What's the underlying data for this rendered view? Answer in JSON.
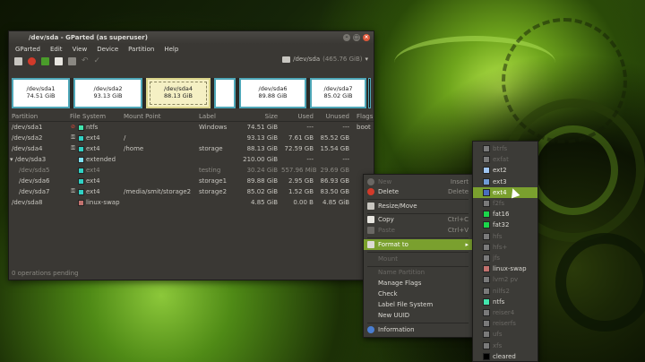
{
  "window": {
    "title": "/dev/sda - GParted (as superuser)",
    "menu": [
      "GParted",
      "Edit",
      "View",
      "Device",
      "Partition",
      "Help"
    ],
    "device": "/dev/sda",
    "device_size": "(465.76 GiB)",
    "status": "0 operations pending"
  },
  "diskmap": [
    {
      "name": "/dev/sda1",
      "size": "74.51 GiB"
    },
    {
      "name": "/dev/sda2",
      "size": "93.13 GiB"
    },
    {
      "name": "/dev/sda4",
      "size": "88.13 GiB"
    },
    {
      "name": "",
      "size": ""
    },
    {
      "name": "/dev/sda6",
      "size": "89.88 GiB"
    },
    {
      "name": "/dev/sda7",
      "size": "85.02 GiB"
    },
    {
      "name": "",
      "size": ""
    }
  ],
  "table": {
    "headers": [
      "Partition",
      "File System",
      "Mount Point",
      "Label",
      "Size",
      "Used",
      "Unused",
      "Flags"
    ],
    "rows": [
      {
        "partition": "/dev/sda1",
        "fs": "ntfs",
        "color": "#42e5ac",
        "icon": "stop",
        "mount": "",
        "label": "Windows",
        "size": "74.51 GiB",
        "used": "---",
        "unused": "---",
        "flags": "boot"
      },
      {
        "partition": "/dev/sda2",
        "fs": "ext4",
        "color": "#31d1c4",
        "icon": "key",
        "mount": "/",
        "label": "",
        "size": "93.13 GiB",
        "used": "7.61 GB",
        "unused": "85.52 GB",
        "flags": ""
      },
      {
        "partition": "/dev/sda4",
        "fs": "ext4",
        "color": "#31d1c4",
        "icon": "key",
        "mount": "/home",
        "label": "storage",
        "size": "88.13 GiB",
        "used": "72.59 GB",
        "unused": "15.54 GB",
        "flags": ""
      },
      {
        "partition": "/dev/sda3",
        "fs": "extended",
        "color": "#7fe0f0",
        "icon": "",
        "mount": "",
        "label": "",
        "size": "210.00 GiB",
        "used": "---",
        "unused": "---",
        "flags": ""
      },
      {
        "partition": "/dev/sda5",
        "fs": "ext4",
        "color": "#31d1c4",
        "icon": "",
        "mount": "",
        "label": "testing",
        "size": "30.24 GiB",
        "used": "557.96 MiB",
        "unused": "29.69 GB",
        "flags": ""
      },
      {
        "partition": "/dev/sda6",
        "fs": "ext4",
        "color": "#31d1c4",
        "icon": "",
        "mount": "",
        "label": "storage1",
        "size": "89.88 GiB",
        "used": "2.95 GB",
        "unused": "86.93 GB",
        "flags": ""
      },
      {
        "partition": "/dev/sda7",
        "fs": "ext4",
        "color": "#31d1c4",
        "icon": "key",
        "mount": "/media/smit/storage2",
        "label": "storage2",
        "size": "85.02 GiB",
        "used": "1.52 GB",
        "unused": "83.50 GB",
        "flags": ""
      },
      {
        "partition": "/dev/sda8",
        "fs": "linux-swap",
        "color": "#c2726e",
        "icon": "",
        "mount": "",
        "label": "",
        "size": "4.85 GiB",
        "used": "0.00 B",
        "unused": "4.85 GiB",
        "flags": ""
      }
    ]
  },
  "context_menu": {
    "items": [
      {
        "label": "New",
        "shortcut": "Insert",
        "disabled": true
      },
      {
        "label": "Delete",
        "shortcut": "Delete",
        "disabled": false
      },
      {
        "label": "Resize/Move",
        "shortcut": "",
        "disabled": false
      },
      {
        "label": "Copy",
        "shortcut": "Ctrl+C",
        "disabled": false
      },
      {
        "label": "Paste",
        "shortcut": "Ctrl+V",
        "disabled": true
      },
      {
        "label": "Format to",
        "shortcut": "",
        "disabled": false
      },
      {
        "label": "Mount",
        "shortcut": "",
        "disabled": true
      },
      {
        "label": "Name Partition",
        "shortcut": "",
        "disabled": true
      },
      {
        "label": "Manage Flags",
        "shortcut": "",
        "disabled": false
      },
      {
        "label": "Check",
        "shortcut": "",
        "disabled": false
      },
      {
        "label": "Label File System",
        "shortcut": "",
        "disabled": false
      },
      {
        "label": "New UUID",
        "shortcut": "",
        "disabled": false
      },
      {
        "label": "Information",
        "shortcut": "",
        "disabled": false
      }
    ]
  },
  "format_submenu": {
    "items": [
      {
        "label": "btrfs",
        "color": "#7a7a7a",
        "disabled": true
      },
      {
        "label": "exfat",
        "color": "#7a7a7a",
        "disabled": true
      },
      {
        "label": "ext2",
        "color": "#9ec4f0",
        "disabled": false
      },
      {
        "label": "ext3",
        "color": "#6f9ad6",
        "disabled": false
      },
      {
        "label": "ext4",
        "color": "#4a6ec0",
        "disabled": false
      },
      {
        "label": "f2fs",
        "color": "#7a7a7a",
        "disabled": true
      },
      {
        "label": "fat16",
        "color": "#1bd64a",
        "disabled": false
      },
      {
        "label": "fat32",
        "color": "#1bd64a",
        "disabled": false
      },
      {
        "label": "hfs",
        "color": "#7a7a7a",
        "disabled": true
      },
      {
        "label": "hfs+",
        "color": "#7a7a7a",
        "disabled": true
      },
      {
        "label": "jfs",
        "color": "#7a7a7a",
        "disabled": true
      },
      {
        "label": "linux-swap",
        "color": "#c2726e",
        "disabled": false
      },
      {
        "label": "lvm2 pv",
        "color": "#7a7a7a",
        "disabled": true
      },
      {
        "label": "nilfs2",
        "color": "#7a7a7a",
        "disabled": true
      },
      {
        "label": "ntfs",
        "color": "#42e5ac",
        "disabled": false
      },
      {
        "label": "reiser4",
        "color": "#7a7a7a",
        "disabled": true
      },
      {
        "label": "reiserfs",
        "color": "#7a7a7a",
        "disabled": true
      },
      {
        "label": "ufs",
        "color": "#7a7a7a",
        "disabled": true
      },
      {
        "label": "xfs",
        "color": "#7a7a7a",
        "disabled": true
      },
      {
        "label": "cleared",
        "color": "#000000",
        "disabled": false
      }
    ],
    "highlighted": "ext4"
  }
}
